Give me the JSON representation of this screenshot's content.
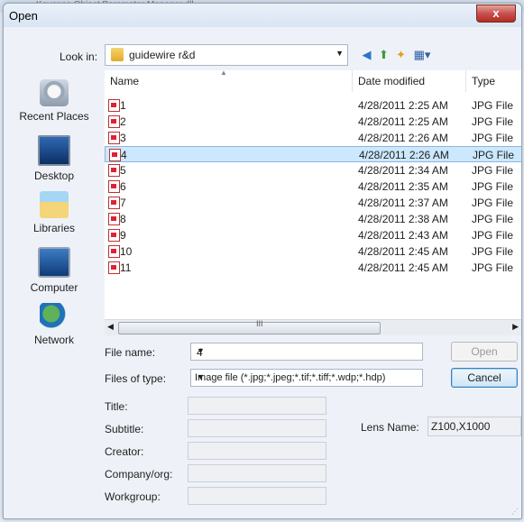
{
  "background": {
    "partial_text": "Keyence Object Parameter Manager.dll"
  },
  "window": {
    "title": "Open",
    "close_label": "x"
  },
  "lookin": {
    "label": "Look in:",
    "value": "guidewire r&d"
  },
  "toolbar": {
    "back_icon": "back-arrow-icon",
    "up_icon": "up-folder-icon",
    "new_icon": "new-folder-icon",
    "view_icon": "view-menu-icon"
  },
  "places": [
    {
      "label": "Recent Places",
      "icon": "recent-places-icon"
    },
    {
      "label": "Desktop",
      "icon": "desktop-icon"
    },
    {
      "label": "Libraries",
      "icon": "libraries-icon"
    },
    {
      "label": "Computer",
      "icon": "computer-icon"
    },
    {
      "label": "Network",
      "icon": "network-icon"
    }
  ],
  "columns": {
    "name": "Name",
    "date": "Date modified",
    "type": "Type"
  },
  "files": [
    {
      "name": "1",
      "date": "4/28/2011 2:25 AM",
      "type": "JPG File"
    },
    {
      "name": "2",
      "date": "4/28/2011 2:25 AM",
      "type": "JPG File"
    },
    {
      "name": "3",
      "date": "4/28/2011 2:26 AM",
      "type": "JPG File"
    },
    {
      "name": "4",
      "date": "4/28/2011 2:26 AM",
      "type": "JPG File",
      "selected": true
    },
    {
      "name": "5",
      "date": "4/28/2011 2:34 AM",
      "type": "JPG File"
    },
    {
      "name": "6",
      "date": "4/28/2011 2:35 AM",
      "type": "JPG File"
    },
    {
      "name": "7",
      "date": "4/28/2011 2:37 AM",
      "type": "JPG File"
    },
    {
      "name": "8",
      "date": "4/28/2011 2:38 AM",
      "type": "JPG File"
    },
    {
      "name": "9",
      "date": "4/28/2011 2:43 AM",
      "type": "JPG File"
    },
    {
      "name": "10",
      "date": "4/28/2011 2:45 AM",
      "type": "JPG File"
    },
    {
      "name": "11",
      "date": "4/28/2011 2:45 AM",
      "type": "JPG File"
    }
  ],
  "scrollbar": {
    "grip": "III"
  },
  "filename": {
    "label": "File name:",
    "value": "4"
  },
  "filetype": {
    "label": "Files of type:",
    "value": "Image file (*.jpg;*.jpeg;*.tif;*.tiff;*.wdp;*.hdp)"
  },
  "buttons": {
    "open": "Open",
    "cancel": "Cancel"
  },
  "metadata": {
    "title_label": "Title:",
    "subtitle_label": "Subtitle:",
    "creator_label": "Creator:",
    "company_label": "Company/org:",
    "workgroup_label": "Workgroup:",
    "lens_label": "Lens Name:",
    "lens_value": "Z100,X1000"
  }
}
